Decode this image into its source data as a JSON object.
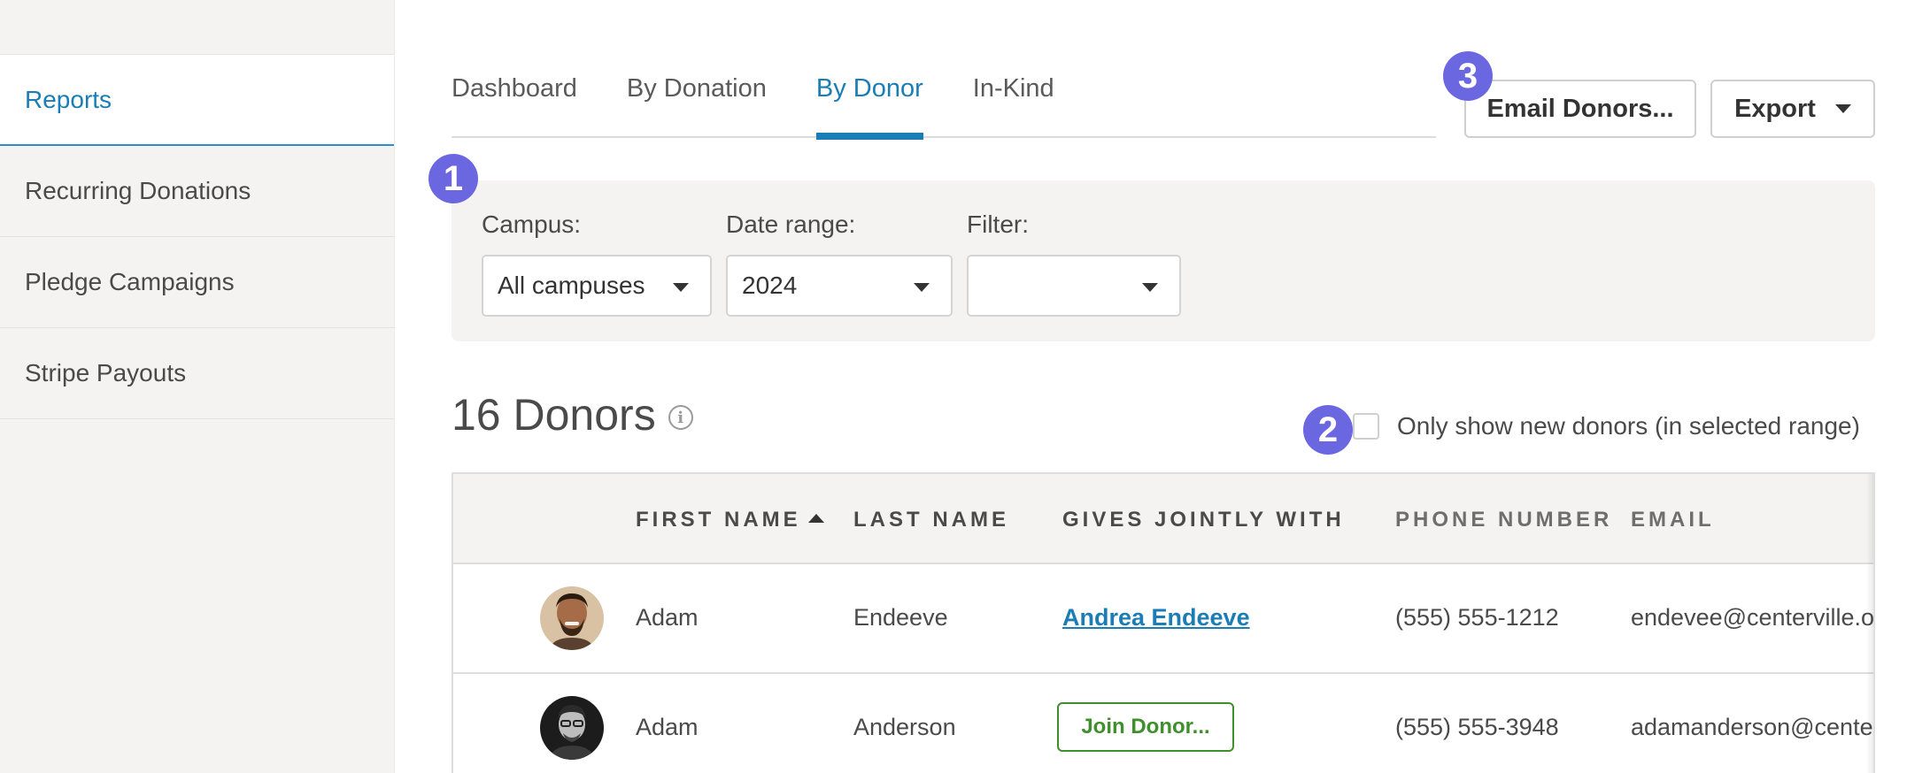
{
  "sidebar": {
    "items": [
      {
        "label": "Reports"
      },
      {
        "label": "Recurring Donations"
      },
      {
        "label": "Pledge Campaigns"
      },
      {
        "label": "Stripe Payouts"
      }
    ]
  },
  "tabs": [
    {
      "label": "Dashboard"
    },
    {
      "label": "By Donation"
    },
    {
      "label": "By Donor"
    },
    {
      "label": "In-Kind"
    }
  ],
  "actions": {
    "email_label": "Email Donors...",
    "export_label": "Export"
  },
  "badges": [
    "1",
    "2",
    "3"
  ],
  "filters": {
    "campus": {
      "label": "Campus:",
      "value": "All campuses"
    },
    "date_range": {
      "label": "Date range:",
      "value": "2024"
    },
    "filter": {
      "label": "Filter:",
      "value": ""
    }
  },
  "donors": {
    "count_label": "16 Donors",
    "info_glyph": "i",
    "new_donors_label": "Only show new donors (in selected range)"
  },
  "table": {
    "columns": {
      "first_name": "FIRST NAME",
      "last_name": "LAST NAME",
      "gives_jointly": "GIVES JOINTLY WITH",
      "phone": "PHONE NUMBER",
      "email": "EMAIL"
    },
    "rows": [
      {
        "first": "Adam",
        "last": "Endeeve",
        "joint": "Andrea Endeeve",
        "phone": "(555) 555-1212",
        "email": "endevee@centerville.org"
      },
      {
        "first": "Adam",
        "last": "Anderson",
        "joint_button": "Join Donor...",
        "phone": "(555) 555-3948",
        "email": "adamanderson@centerville.org"
      }
    ]
  },
  "colors": {
    "accent": "#1b7db5",
    "badge": "#6b67e0",
    "join": "#3f8f2d"
  }
}
